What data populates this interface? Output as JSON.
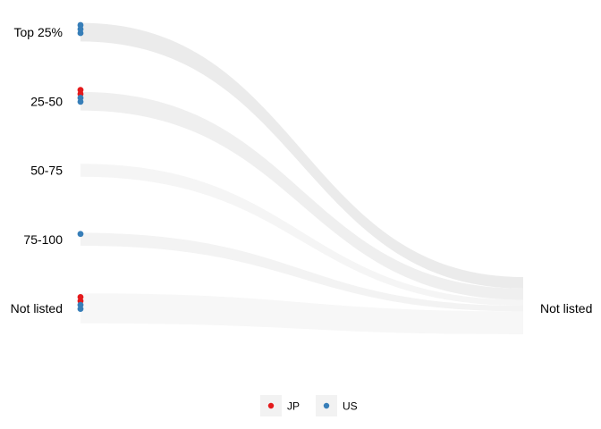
{
  "chart_data": {
    "type": "sankey",
    "title": "",
    "xlabel": "",
    "ylabel": "",
    "left_categories": [
      "Top 25%",
      "25-50",
      "50-75",
      "75-100",
      "Not listed"
    ],
    "right_categories": [
      "Not listed"
    ],
    "flows": [
      {
        "from": "Top 25%",
        "to": "Not listed",
        "weight": 4,
        "color": "#ebebeb"
      },
      {
        "from": "25-50",
        "to": "Not listed",
        "weight": 4,
        "color": "#efefef"
      },
      {
        "from": "50-75",
        "to": "Not listed",
        "weight": 2,
        "color": "#f5f5f5"
      },
      {
        "from": "75-100",
        "to": "Not listed",
        "weight": 2,
        "color": "#f3f3f3"
      },
      {
        "from": "Not listed",
        "to": "Not listed",
        "weight": 8,
        "color": "#f7f7f7"
      }
    ],
    "series": [
      {
        "name": "JP",
        "color": "#e41a1c",
        "points": [
          {
            "category": "25-50",
            "count": 2
          },
          {
            "category": "Not listed",
            "count": 2
          }
        ]
      },
      {
        "name": "US",
        "color": "#377eb8",
        "points": [
          {
            "category": "Top 25%",
            "count": 3
          },
          {
            "category": "25-50",
            "count": 2
          },
          {
            "category": "75-100",
            "count": 1
          },
          {
            "category": "Not listed",
            "count": 2
          }
        ]
      }
    ],
    "legend": {
      "position": "bottom",
      "entries": [
        "JP",
        "US"
      ]
    }
  }
}
